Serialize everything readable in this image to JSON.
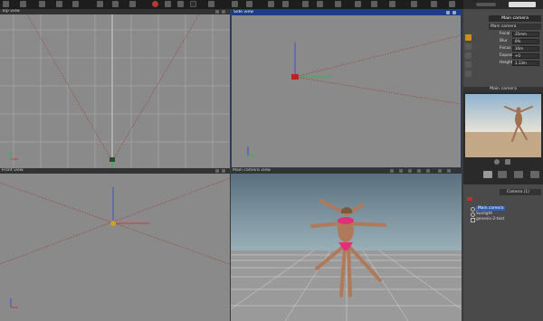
{
  "viewports": {
    "top_left": {
      "title": "Top view"
    },
    "top_right": {
      "title": "Side view"
    },
    "bottom_left": {
      "title": "Front view"
    },
    "bottom_right": {
      "title": "Main camera view"
    }
  },
  "properties_panel": {
    "tab_label": "Main camera",
    "camera_select": "Main camera",
    "fields": [
      {
        "label": "Focal",
        "value": "35mm"
      },
      {
        "label": "Blur",
        "value": "0%"
      },
      {
        "label": "Focus",
        "value": "10m"
      },
      {
        "label": "Exposure",
        "value": "+0"
      },
      {
        "label": "Height",
        "value": "1.13m"
      }
    ]
  },
  "preview_panel": {
    "title": "Main camera"
  },
  "scene_panel": {
    "camera_dropdown": "Camera (1)",
    "tree": [
      {
        "label": "Main camera",
        "selected": true
      },
      {
        "label": "Sunlight",
        "selected": false
      },
      {
        "label": "genesis-2-test",
        "selected": false
      }
    ]
  },
  "colors": {
    "active_title": "#1d3d86",
    "grid_bg": "#8a8a8a",
    "selection": "#2f5fb8",
    "axis_x": "#e02020",
    "axis_y": "#20c040",
    "axis_z": "#2040e0",
    "frustum": "#a03030"
  }
}
